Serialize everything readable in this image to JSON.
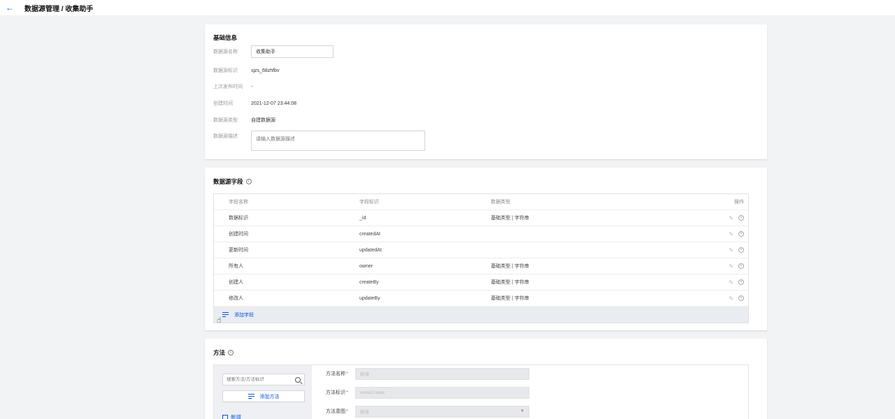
{
  "header": {
    "title": "数据源管理 / 收集助手"
  },
  "basic": {
    "title": "基础信息",
    "name_label": "数据源名称",
    "name_value": "收集助手",
    "id_label": "数据源标识",
    "id_value": "sjzs_68zhfbv",
    "published_label": "上次发布时间",
    "published_value": "-",
    "created_label": "创建时间",
    "created_value": "2021-12-07 23:44:08",
    "type_label": "数据源类型",
    "type_value": "自建数据源",
    "desc_label": "数据源描述",
    "desc_placeholder": "请输入数据源描述"
  },
  "fields": {
    "title": "数据源字段",
    "columns": {
      "name": "字段名称",
      "key": "字段标识",
      "type": "数据类型",
      "ops": "操作"
    },
    "rows": [
      {
        "name": "数据标识",
        "key": "_id",
        "type": "基础类型 | 字符串"
      },
      {
        "name": "创建时间",
        "key": "createdAt",
        "type": ""
      },
      {
        "name": "更新时间",
        "key": "updatedAt",
        "type": ""
      },
      {
        "name": "所有人",
        "key": "owner",
        "type": "基础类型 | 字符串"
      },
      {
        "name": "创建人",
        "key": "createBy",
        "type": "基础类型 | 字符串"
      },
      {
        "name": "修改人",
        "key": "updateBy",
        "type": "基础类型 | 字符串"
      }
    ],
    "add_label": "添加字段"
  },
  "methods": {
    "title": "方法",
    "search_placeholder": "搜索方法/方法标识",
    "add_label": "添加方法",
    "items": [
      "新增"
    ],
    "name_label": "方法名称",
    "name_value": "新增",
    "key_label": "方法标识",
    "key_value": "wedaCreate",
    "intent_label": "方法意图",
    "intent_value": "新增"
  }
}
